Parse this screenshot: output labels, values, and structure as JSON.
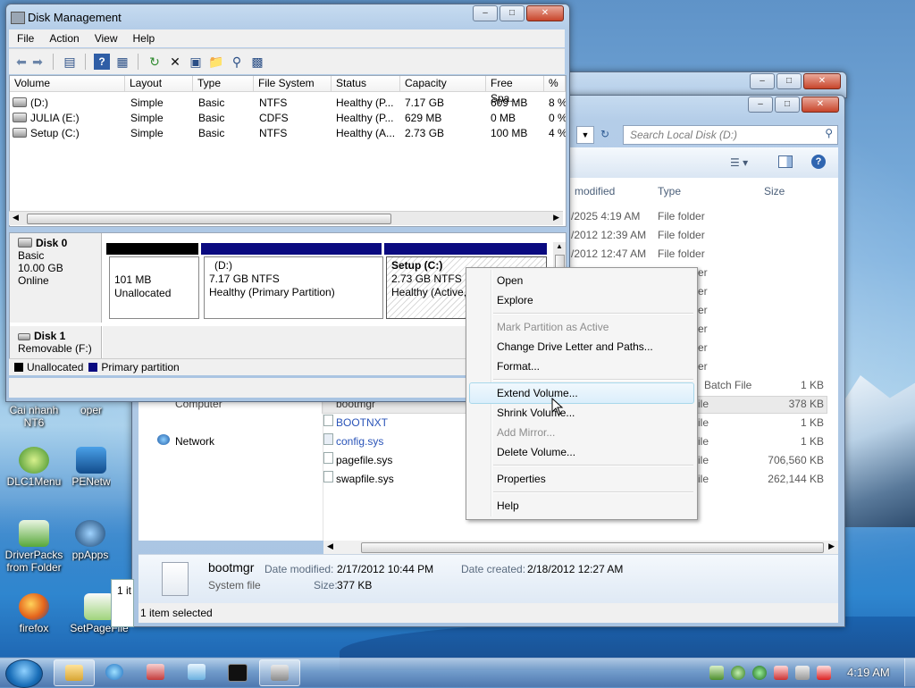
{
  "disk_management": {
    "title": "Disk Management",
    "menu": [
      "File",
      "Action",
      "View",
      "Help"
    ],
    "columns": [
      "Volume",
      "Layout",
      "Type",
      "File System",
      "Status",
      "Capacity",
      "Free Spa...",
      "% F"
    ],
    "volumes": [
      {
        "name": "(D:)",
        "layout": "Simple",
        "type": "Basic",
        "fs": "NTFS",
        "status": "Healthy (P...",
        "capacity": "7.17 GB",
        "free": "609 MB",
        "pct": "8 %"
      },
      {
        "name": "JULIA (E:)",
        "layout": "Simple",
        "type": "Basic",
        "fs": "CDFS",
        "status": "Healthy (P...",
        "capacity": "629 MB",
        "free": "0 MB",
        "pct": "0 %"
      },
      {
        "name": "Setup (C:)",
        "layout": "Simple",
        "type": "Basic",
        "fs": "NTFS",
        "status": "Healthy (A...",
        "capacity": "2.73 GB",
        "free": "100 MB",
        "pct": "4 %"
      }
    ],
    "disk0": {
      "name": "Disk 0",
      "type": "Basic",
      "size": "10.00 GB",
      "state": "Online"
    },
    "partitions": [
      {
        "title": "",
        "size": "101 MB",
        "desc": "Unallocated"
      },
      {
        "title": "(D:)",
        "size": "7.17 GB NTFS",
        "desc": "Healthy (Primary Partition)"
      },
      {
        "title": "Setup  (C:)",
        "size": "2.73 GB NTFS",
        "desc": "Healthy (Active,"
      }
    ],
    "disk1": {
      "name": "Disk 1",
      "type": "Removable (F:)"
    },
    "legend": {
      "unallocated": "Unallocated",
      "primary": "Primary partition"
    }
  },
  "context_menu": {
    "items": [
      {
        "label": "Open",
        "disabled": false
      },
      {
        "label": "Explore",
        "disabled": false
      },
      {
        "label": "Mark Partition as Active",
        "disabled": true
      },
      {
        "label": "Change Drive Letter and Paths...",
        "disabled": false
      },
      {
        "label": "Format...",
        "disabled": false
      },
      {
        "label": "Extend Volume...",
        "disabled": false
      },
      {
        "label": "Shrink Volume...",
        "disabled": false
      },
      {
        "label": "Add Mirror...",
        "disabled": true
      },
      {
        "label": "Delete Volume...",
        "disabled": false
      },
      {
        "label": "Properties",
        "disabled": false
      },
      {
        "label": "Help",
        "disabled": false
      }
    ]
  },
  "explorer": {
    "search_placeholder": "Search Local Disk (D:)",
    "columns": {
      "modified": "modified",
      "type": "Type",
      "size": "Size"
    },
    "folder_rows": [
      {
        "date": "/2025 4:19 AM",
        "type": "File folder"
      },
      {
        "date": "/2012 12:39 AM",
        "type": "File folder"
      },
      {
        "date": "/2012 12:47 AM",
        "type": "File folder"
      }
    ],
    "partial_types": [
      "er",
      "er",
      "er",
      "er",
      "er",
      "er"
    ],
    "files": [
      {
        "name": "bootmgr",
        "type": "ile",
        "size": "378 KB"
      },
      {
        "name": "BOOTNXT",
        "type": "ile",
        "size": "1 KB"
      },
      {
        "name": "config.sys",
        "type": "ile",
        "size": "1 KB"
      },
      {
        "name": "pagefile.sys",
        "type": "ile",
        "size": "706,560 KB"
      },
      {
        "name": "swapfile.sys",
        "type": "ile",
        "size": "262,144 KB"
      }
    ],
    "batch_row": {
      "type": "Batch File",
      "size": "1 KB"
    },
    "nav": {
      "computer": "Computer",
      "network": "Network"
    },
    "details": {
      "name": "bootmgr",
      "kind": "System file",
      "modified_label": "Date modified:",
      "modified": "2/17/2012 10:44 PM",
      "created_label": "Date created:",
      "created": "2/18/2012 12:27 AM",
      "size_label": "Size:",
      "size": "377 KB"
    },
    "status": "1 item selected",
    "left_count": "1 it"
  },
  "desktop_icons": [
    {
      "label": "Cai nhanh NT6"
    },
    {
      "label": "oper"
    },
    {
      "label": "DLC1Menu"
    },
    {
      "label": "PENetw"
    },
    {
      "label": "DriverPacks from Folder"
    },
    {
      "label": "ppApps"
    },
    {
      "label": "firefox"
    },
    {
      "label": "SetPageFile"
    }
  ],
  "taskbar": {
    "clock": "4:19 AM"
  }
}
